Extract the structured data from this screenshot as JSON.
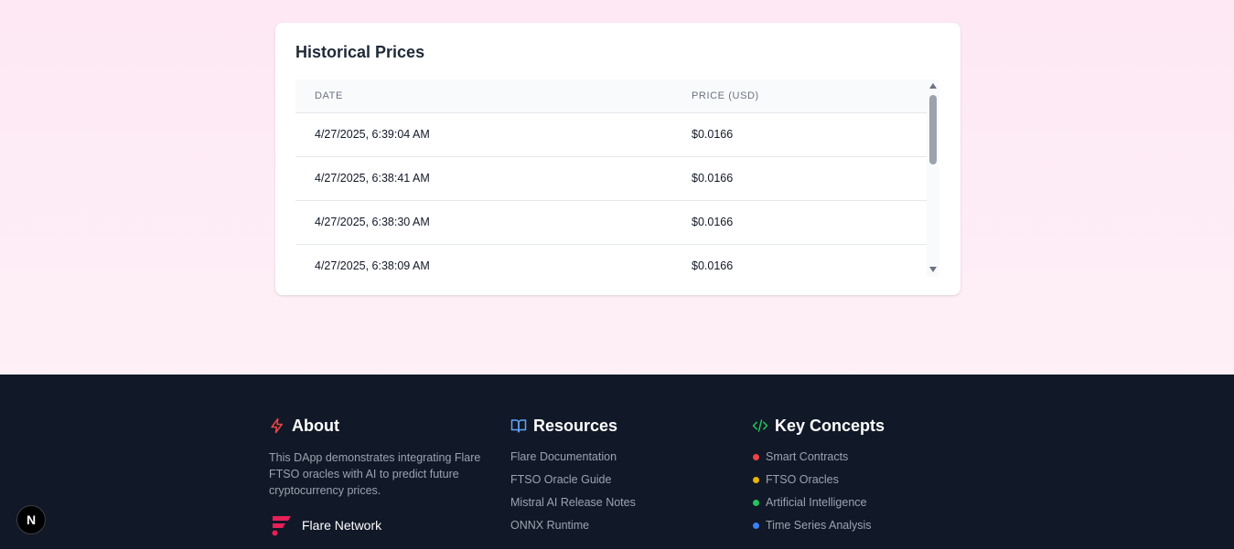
{
  "historical": {
    "title": "Historical Prices",
    "columns": [
      "DATE",
      "PRICE (USD)"
    ],
    "rows": [
      {
        "date": "4/27/2025, 6:39:04 AM",
        "price": "$0.0166"
      },
      {
        "date": "4/27/2025, 6:38:41 AM",
        "price": "$0.0166"
      },
      {
        "date": "4/27/2025, 6:38:30 AM",
        "price": "$0.0166"
      },
      {
        "date": "4/27/2025, 6:38:09 AM",
        "price": "$0.0166"
      }
    ]
  },
  "footer": {
    "about": {
      "title": "About",
      "icon": "lightning-icon",
      "text": "This DApp demonstrates integrating Flare FTSO oracles with AI to predict future cryptocurrency prices.",
      "brand": "Flare Network"
    },
    "resources": {
      "title": "Resources",
      "icon": "book-icon",
      "links": [
        "Flare Documentation",
        "FTSO Oracle Guide",
        "Mistral AI Release Notes",
        "ONNX Runtime"
      ]
    },
    "concepts": {
      "title": "Key Concepts",
      "icon": "code-icon",
      "items": [
        {
          "label": "Smart Contracts",
          "color": "#ef4444"
        },
        {
          "label": "FTSO Oracles",
          "color": "#eab308"
        },
        {
          "label": "Artificial Intelligence",
          "color": "#22c55e"
        },
        {
          "label": "Time Series Analysis",
          "color": "#3b82f6"
        }
      ]
    }
  },
  "next_badge": "N",
  "colors": {
    "footer_bg": "#111827",
    "accent_red": "#ef4444",
    "accent_blue": "#60a5fa",
    "accent_green": "#22c55e",
    "flare_pink": "#e62058"
  }
}
